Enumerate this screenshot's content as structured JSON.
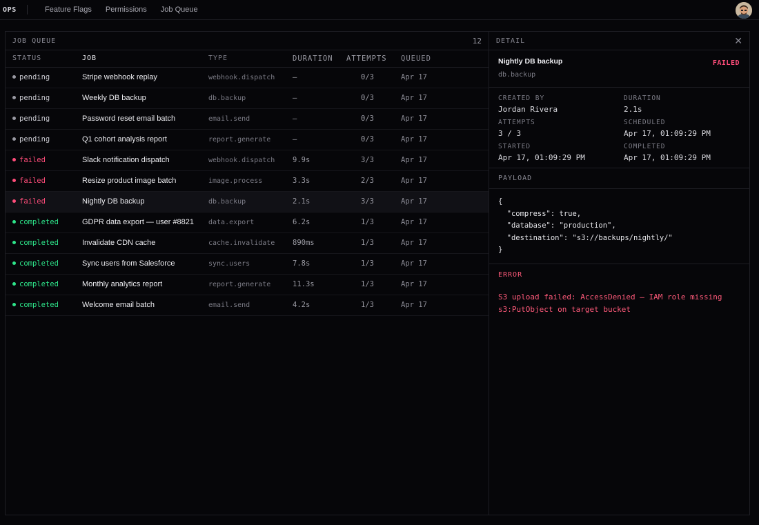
{
  "brand": "OPS",
  "nav": [
    "Feature Flags",
    "Permissions",
    "Job Queue"
  ],
  "colors": {
    "pending": "#9a9aa3",
    "failed": "#ff4d7a",
    "completed": "#2ee58a",
    "error": "#ff5a7a"
  },
  "queue": {
    "title": "JOB QUEUE",
    "count": "12",
    "columns": [
      "STATUS",
      "JOB",
      "TYPE",
      "DURATION",
      "ATTEMPTS",
      "QUEUED"
    ],
    "rows": [
      {
        "status": "pending",
        "job": "Stripe webhook replay",
        "type": "webhook.dispatch",
        "duration": "—",
        "attempts": "0/3",
        "queued": "Apr 17"
      },
      {
        "status": "pending",
        "job": "Weekly DB backup",
        "type": "db.backup",
        "duration": "—",
        "attempts": "0/3",
        "queued": "Apr 17"
      },
      {
        "status": "pending",
        "job": "Password reset email batch",
        "type": "email.send",
        "duration": "—",
        "attempts": "0/3",
        "queued": "Apr 17"
      },
      {
        "status": "pending",
        "job": "Q1 cohort analysis report",
        "type": "report.generate",
        "duration": "—",
        "attempts": "0/3",
        "queued": "Apr 17"
      },
      {
        "status": "failed",
        "job": "Slack notification dispatch",
        "type": "webhook.dispatch",
        "duration": "9.9s",
        "attempts": "3/3",
        "queued": "Apr 17"
      },
      {
        "status": "failed",
        "job": "Resize product image batch",
        "type": "image.process",
        "duration": "3.3s",
        "attempts": "2/3",
        "queued": "Apr 17"
      },
      {
        "status": "failed",
        "job": "Nightly DB backup",
        "type": "db.backup",
        "duration": "2.1s",
        "attempts": "3/3",
        "queued": "Apr 17",
        "selected": true
      },
      {
        "status": "completed",
        "job": "GDPR data export — user #8821",
        "type": "data.export",
        "duration": "6.2s",
        "attempts": "1/3",
        "queued": "Apr 17"
      },
      {
        "status": "completed",
        "job": "Invalidate CDN cache",
        "type": "cache.invalidate",
        "duration": "890ms",
        "attempts": "1/3",
        "queued": "Apr 17"
      },
      {
        "status": "completed",
        "job": "Sync users from Salesforce",
        "type": "sync.users",
        "duration": "7.8s",
        "attempts": "1/3",
        "queued": "Apr 17"
      },
      {
        "status": "completed",
        "job": "Monthly analytics report",
        "type": "report.generate",
        "duration": "11.3s",
        "attempts": "1/3",
        "queued": "Apr 17"
      },
      {
        "status": "completed",
        "job": "Welcome email batch",
        "type": "email.send",
        "duration": "4.2s",
        "attempts": "1/3",
        "queued": "Apr 17"
      }
    ]
  },
  "detail": {
    "title": "DETAIL",
    "close": "✕",
    "name": "Nightly DB backup",
    "type": "db.backup",
    "badge": "FAILED",
    "meta": [
      {
        "label": "CREATED BY",
        "value": "Jordan Rivera"
      },
      {
        "label": "DURATION",
        "value": "2.1s"
      },
      {
        "label": "ATTEMPTS",
        "value": "3 / 3"
      },
      {
        "label": "SCHEDULED",
        "value": "Apr 17, 01:09:29 PM"
      },
      {
        "label": "STARTED",
        "value": "Apr 17, 01:09:29 PM"
      },
      {
        "label": "COMPLETED",
        "value": "Apr 17, 01:09:29 PM"
      }
    ],
    "payload_label": "PAYLOAD",
    "payload": "{\n  \"compress\": true,\n  \"database\": \"production\",\n  \"destination\": \"s3://backups/nightly/\"\n}",
    "error_label": "ERROR",
    "error": "S3 upload failed: AccessDenied — IAM role missing s3:PutObject on target bucket"
  }
}
